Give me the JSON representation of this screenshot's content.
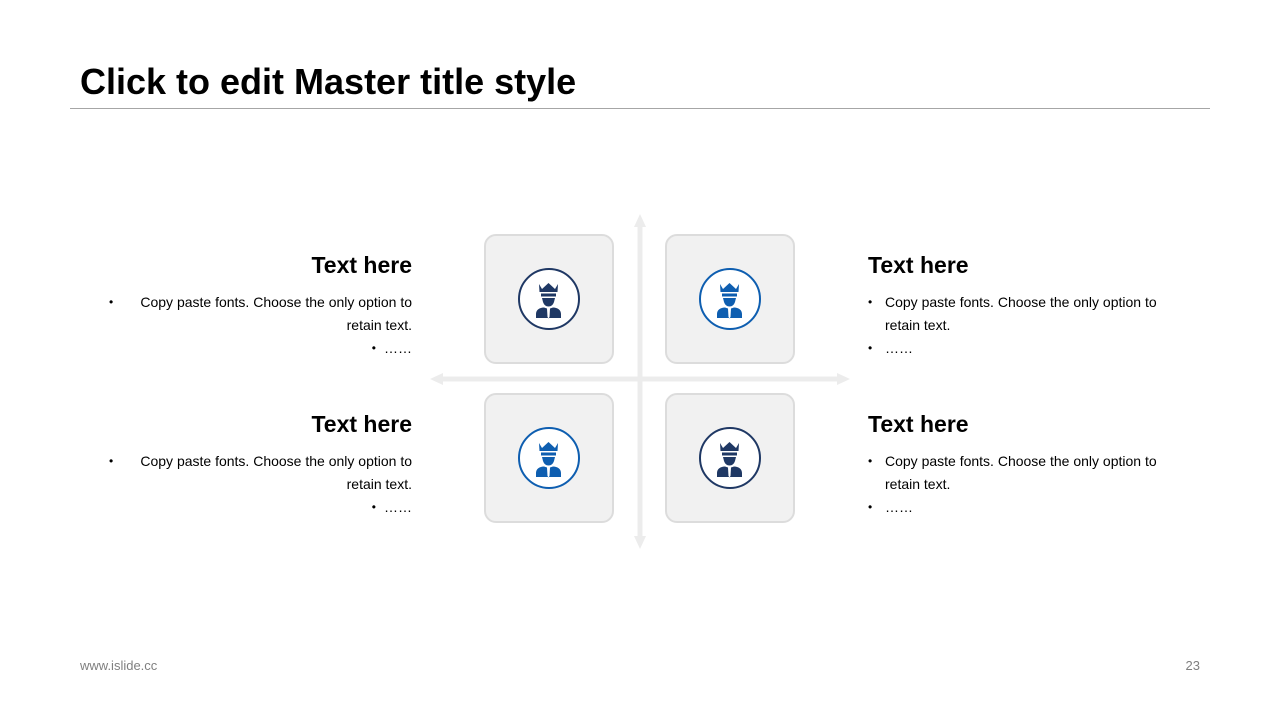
{
  "slide": {
    "title": "Click to edit Master title style",
    "footer_url": "www.islide.cc",
    "page_number": "23"
  },
  "quadrants": [
    {
      "heading": "Text here",
      "bullet_text": "Copy paste fonts. Choose the only option to retain text.",
      "bullet_more": "……",
      "icon": "king-person-icon",
      "icon_color": "#1f3864"
    },
    {
      "heading": "Text here",
      "bullet_text": "Copy paste fonts. Choose the only option to retain text.",
      "bullet_more": "……",
      "icon": "king-person-icon",
      "icon_color": "#0e5eb0"
    },
    {
      "heading": "Text here",
      "bullet_text": "Copy paste fonts. Choose the only option to retain text.",
      "bullet_more": "……",
      "icon": "king-person-icon",
      "icon_color": "#0e5eb0"
    },
    {
      "heading": "Text here",
      "bullet_text": "Copy paste fonts. Choose the only option to retain text.",
      "bullet_more": "……",
      "icon": "king-person-icon",
      "icon_color": "#1f3864"
    }
  ],
  "colors": {
    "dark_navy": "#1f3864",
    "blue": "#0e5eb0",
    "tile_bg": "#f1f1f1",
    "axis": "#ececec"
  }
}
